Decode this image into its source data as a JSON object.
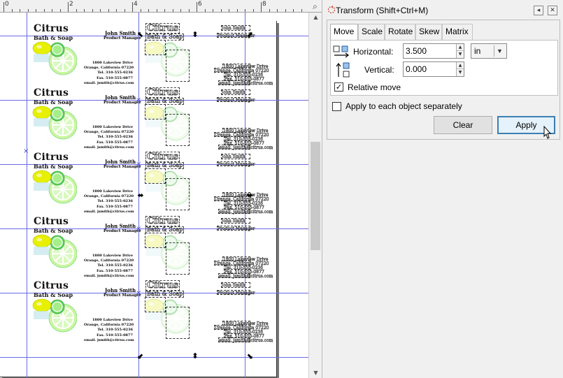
{
  "ruler": {
    "numbers": [
      "0",
      "2",
      "4",
      "6",
      "8"
    ],
    "corner_label": "⌕"
  },
  "cards": [
    {
      "logo_title": "Citrus",
      "logo_sub": "Bath & Soap",
      "name": "John Smith",
      "role": "Product Manager",
      "address": [
        "1800 Lakeview Drive",
        "Orange, California 07220",
        "Tel. 310-555-0236",
        "Fax. 510-555-0877",
        "email. jsmith@citrus.com"
      ]
    },
    {
      "logo_title": "Citrus",
      "logo_sub": "Bath & Soap",
      "name": "John Smith",
      "role": "Product Manager",
      "address": [
        "1800 Lakeview Drive",
        "Orange, California 07220",
        "Tel. 310-555-0236",
        "Fax. 510-555-0877",
        "email. jsmith@citrus.com"
      ]
    },
    {
      "logo_title": "Citrus",
      "logo_sub": "Bath & Soap",
      "name": "John Smith",
      "role": "Product Manager",
      "address": [
        "1800 Lakeview Drive",
        "Orange, California 07220",
        "Tel. 310-555-0236",
        "Fax. 510-555-0877",
        "email. jsmith@citrus.com"
      ]
    },
    {
      "logo_title": "Citrus",
      "logo_sub": "Bath & Soap",
      "name": "John Smith",
      "role": "Product Manager",
      "address": [
        "1800 Lakeview Drive",
        "Orange, California 07220",
        "Tel. 310-555-0236",
        "Fax. 510-555-0877",
        "email. jsmith@citrus.com"
      ]
    },
    {
      "logo_title": "Citrus",
      "logo_sub": "Bath & Soap",
      "name": "John Smith",
      "role": "Product Manager",
      "address": [
        "1800 Lakeview Drive",
        "Orange, California 07220",
        "Tel. 310-555-0236",
        "Fax. 510-555-0877",
        "email. jsmith@citrus.com"
      ]
    }
  ],
  "ghost": {
    "title": "Citrus",
    "sub": "Bath & Soap",
    "name": "John Smith",
    "role": "Product Manager",
    "lines": [
      "1800 Lakeview Drive",
      "Orange, California 07220",
      "Tel. 310-555-0236",
      "Fax. 510-555-0877",
      "email. jsmith@citrus.com"
    ]
  },
  "dialog": {
    "title": "Transform (Shift+Ctrl+M)",
    "tabs": [
      {
        "label": "Move",
        "active": true
      },
      {
        "label": "Scale",
        "active": false
      },
      {
        "label": "Rotate",
        "active": false
      },
      {
        "label": "Skew",
        "active": false
      },
      {
        "label": "Matrix",
        "active": false
      }
    ],
    "horizontal_label": "Horizontal:",
    "horizontal_value": "3.500",
    "vertical_label": "Vertical:",
    "vertical_value": "0.000",
    "unit": "in",
    "relative_move_label": "Relative move",
    "relative_move_checked": true,
    "apply_each_label": "Apply to each object separately",
    "apply_each_checked": false,
    "clear_label": "Clear",
    "apply_label": "Apply"
  },
  "colors": {
    "guide": "#6a6ae6",
    "lime_light": "#ccf5a0",
    "lime_dark": "#5fd65f",
    "lemon": "#e6f000",
    "focus": "#3c7fb1",
    "panel_bg": "#f0f0f0"
  },
  "icons": {
    "search": "magnifier-icon",
    "dock_restore": "dock-restore-icon",
    "dock_close": "dock-close-icon",
    "transform": "transform-icon"
  }
}
